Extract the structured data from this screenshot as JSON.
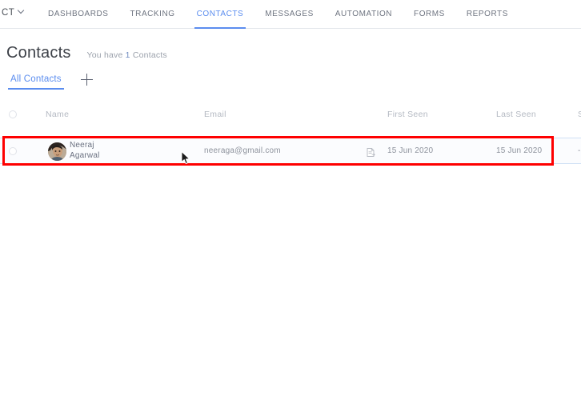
{
  "topnav": {
    "brand": "CT",
    "brand_icon": "chevron-down-icon",
    "items": [
      {
        "label": "DASHBOARDS",
        "active": false
      },
      {
        "label": "TRACKING",
        "active": false
      },
      {
        "label": "CONTACTS",
        "active": true
      },
      {
        "label": "MESSAGES",
        "active": false
      },
      {
        "label": "AUTOMATION",
        "active": false
      },
      {
        "label": "FORMS",
        "active": false
      },
      {
        "label": "REPORTS",
        "active": false
      }
    ]
  },
  "page": {
    "title": "Contacts",
    "subtitle_prefix": "You have",
    "subtitle_count": "1",
    "subtitle_suffix": "Contacts"
  },
  "tabs": {
    "active_tab": "All Contacts",
    "add_label": "+"
  },
  "table": {
    "columns": [
      {
        "key": "select",
        "label": ""
      },
      {
        "key": "name",
        "label": "Name"
      },
      {
        "key": "email",
        "label": "Email"
      },
      {
        "key": "first_seen",
        "label": "First Seen"
      },
      {
        "key": "last_seen",
        "label": "Last Seen"
      },
      {
        "key": "score",
        "label": "S"
      }
    ],
    "rows": [
      {
        "first_name": "Neeraj",
        "last_name": "Agarwal",
        "email": "neeraga@gmail.com",
        "first_seen": "15 Jun 2020",
        "last_seen": "15 Jun 2020",
        "score": "-",
        "avatar": "user-photo-avatar",
        "source_icon": "document-icon"
      }
    ]
  },
  "annotation": {
    "highlight_color": "#fe0000"
  },
  "colors": {
    "accent_blue": "#5b8def",
    "text_dark": "#3d4148",
    "text_muted": "#9ba1ab",
    "row_border": "#cfe0f5"
  }
}
